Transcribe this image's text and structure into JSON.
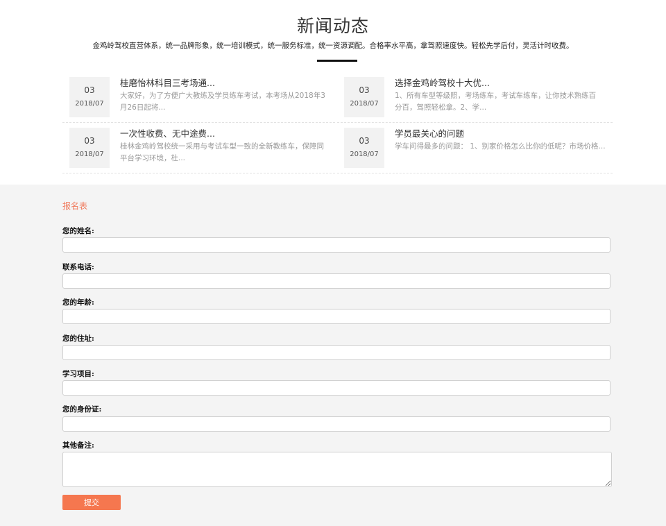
{
  "news": {
    "title": "新闻动态",
    "subtitle": "金鸡岭驾校直营体系，统一品牌形象，统一培训模式，统一服务标准，统一资源调配。合格率水平高，拿驾照速度快。轻松先学后付，灵活计时收费。",
    "items": [
      {
        "day": "03",
        "ym": "2018/07",
        "headline": "桂磨怡林科目三考场通...",
        "summary": "大家好，为了方便广大教练及学员练车考试，本考场从2018年3月26日起将..."
      },
      {
        "day": "03",
        "ym": "2018/07",
        "headline": "选择金鸡岭驾校十大优...",
        "summary": "1、所有车型等级照，考场练车，考试车练车，让你技术熟练百分百，驾照轻松拿。2、学..."
      },
      {
        "day": "03",
        "ym": "2018/07",
        "headline": "一次性收费、无中途费...",
        "summary": "桂林金鸡岭驾校统一采用与考试车型一致的全新教练车，保障同平台学习环境，杜..."
      },
      {
        "day": "03",
        "ym": "2018/07",
        "headline": "学员最关心的问题",
        "summary": "学车问得最多的问题： 1、别家价格怎么比你的低呢？市场价格..."
      }
    ]
  },
  "form": {
    "heading": "报名表",
    "fields": [
      {
        "label": "您的姓名:",
        "value": ""
      },
      {
        "label": "联系电话:",
        "value": ""
      },
      {
        "label": "您的年龄:",
        "value": ""
      },
      {
        "label": "您的住址:",
        "value": ""
      },
      {
        "label": "学习项目:",
        "value": ""
      },
      {
        "label": "您的身份证:",
        "value": ""
      },
      {
        "label": "其他备注:",
        "value": ""
      }
    ],
    "submit_label": "提交"
  },
  "colors": {
    "accent": "#f5774f",
    "heading_accent": "#f07a5c",
    "form_background": "#f4f4f4",
    "date_box": "#f2f2f2"
  }
}
